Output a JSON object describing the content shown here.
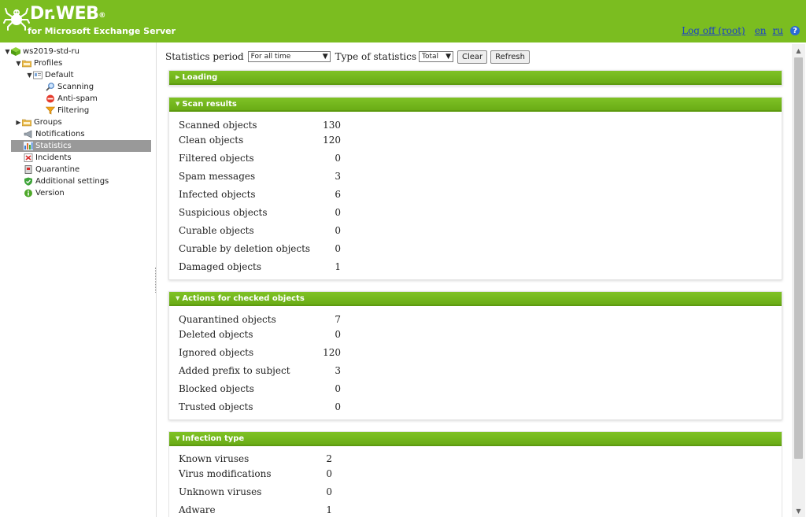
{
  "header": {
    "brand": "Dr.WEB",
    "brand_mark": "®",
    "subtitle": "for Microsoft Exchange Server",
    "logoff": "Log off (root)",
    "lang_en": "en",
    "lang_ru": "ru",
    "help": "?"
  },
  "tree": {
    "server": "ws2019-std-ru",
    "profiles": "Profiles",
    "default": "Default",
    "scanning": "Scanning",
    "antispam": "Anti-spam",
    "filtering": "Filtering",
    "groups": "Groups",
    "notifications": "Notifications",
    "statistics": "Statistics",
    "incidents": "Incidents",
    "quarantine": "Quarantine",
    "additional": "Additional settings",
    "version": "Version"
  },
  "toolbar": {
    "period_label": "Statistics period",
    "period_value": "For all time",
    "type_label": "Type of statistics",
    "type_value": "Total",
    "clear": "Clear",
    "refresh": "Refresh"
  },
  "panels": {
    "loading": "Loading",
    "scan_title": "Scan results",
    "scan": [
      {
        "label": "Scanned objects",
        "value": "130"
      },
      {
        "label": "Clean objects",
        "value": "120"
      },
      {
        "label": "Filtered objects",
        "value": "0"
      },
      {
        "label": "Spam messages",
        "value": "3"
      },
      {
        "label": "Infected objects",
        "value": "6"
      },
      {
        "label": "Suspicious objects",
        "value": "0"
      },
      {
        "label": "Curable objects",
        "value": "0"
      },
      {
        "label": "Curable by deletion objects",
        "value": "0"
      },
      {
        "label": "Damaged objects",
        "value": "1"
      }
    ],
    "actions_title": "Actions for checked objects",
    "actions": [
      {
        "label": "Quarantined objects",
        "value": "7"
      },
      {
        "label": "Deleted objects",
        "value": "0"
      },
      {
        "label": "Ignored objects",
        "value": "120"
      },
      {
        "label": "Added prefix to subject",
        "value": "3"
      },
      {
        "label": "Blocked objects",
        "value": "0"
      },
      {
        "label": "Trusted objects",
        "value": "0"
      }
    ],
    "infection_title": "Infection type",
    "infection": [
      {
        "label": "Known viruses",
        "value": "2"
      },
      {
        "label": "Virus modifications",
        "value": "0"
      },
      {
        "label": "Unknown viruses",
        "value": "0"
      },
      {
        "label": "Adware",
        "value": "1"
      }
    ]
  },
  "colors": {
    "header_green": "#7bbd20",
    "panel_header_green": "#6aac16",
    "link_blue": "#1a3fc8",
    "selected_gray": "#999999"
  }
}
